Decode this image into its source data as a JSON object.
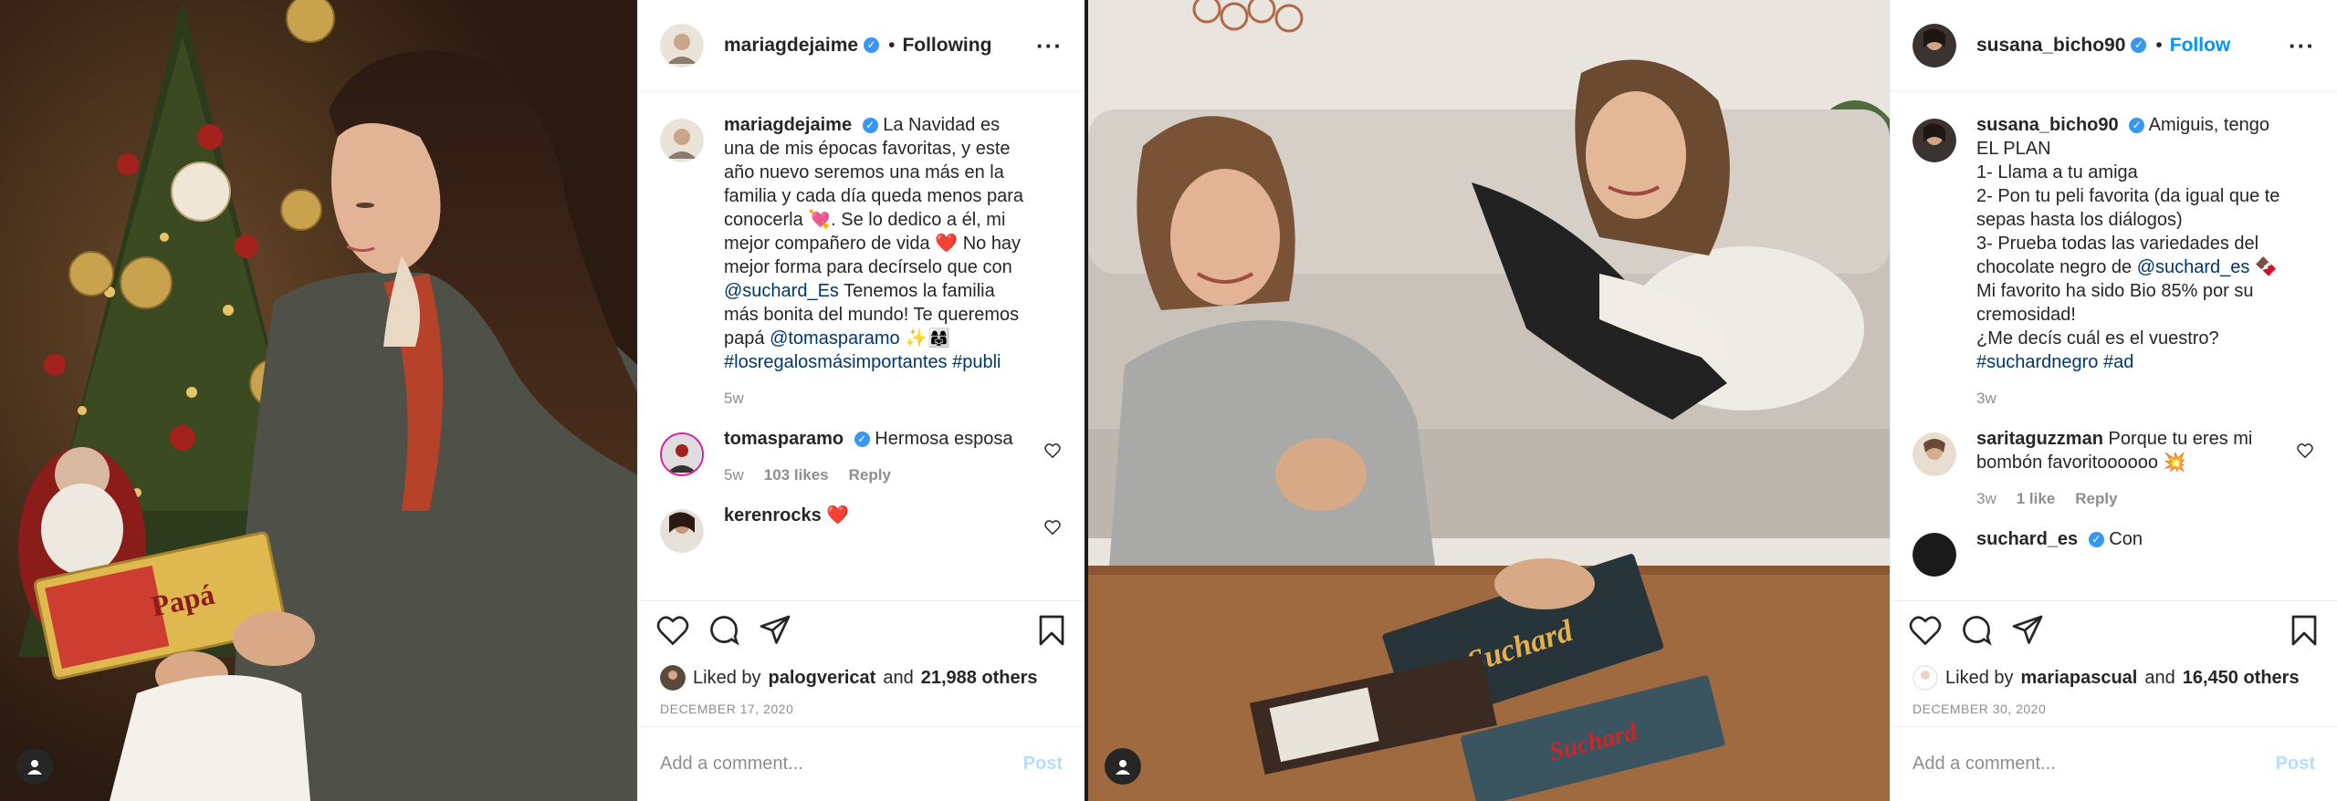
{
  "left_post": {
    "header": {
      "username": "mariagdejaime",
      "follow_state": "Following"
    },
    "caption": {
      "username": "mariagdejaime",
      "text": "La Navidad es una de mis épocas favoritas, y este año nuevo seremos una más en la familia y cada día queda menos para conocerla 💘. Se lo dedico a él, mi mejor compañero de vida ❤️ No hay mejor forma para decírselo que con ",
      "mention1": "@suchard_Es",
      "text2": " Tenemos la familia más bonita del mundo! Te queremos papá ",
      "mention2": "@tomasparamo",
      "emoji": " ✨👩‍👩‍👧",
      "hashtags": "#losregalosmásimportantes #publi",
      "time": "5w"
    },
    "comments": [
      {
        "username": "tomasparamo",
        "text": "Hermosa esposa",
        "time": "5w",
        "likes": "103 likes",
        "reply": "Reply"
      },
      {
        "username": "kerenrocks",
        "text": "❤️"
      }
    ],
    "liked_by": {
      "prefix": "Liked by",
      "user": "palogvericat",
      "and": "and",
      "others": "21,988 others"
    },
    "date": "DECEMBER 17, 2020",
    "add_comment": {
      "placeholder": "Add a comment...",
      "post": "Post"
    }
  },
  "right_post": {
    "header": {
      "username": "susana_bicho90",
      "follow_state": "Follow"
    },
    "caption": {
      "username": "susana_bicho90",
      "text": "Amiguis, tengo EL PLAN\n1- Llama a tu amiga\n2- Pon tu peli favorita (da igual que te sepas hasta los diálogos)\n3- Prueba todas las variedades del chocolate negro de ",
      "mention1": "@suchard_es",
      "text2": " 🍫\nMi favorito ha sido Bio 85% por su cremosidad!\n¿Me decís cuál es el vuestro?\n",
      "hashtags": "#suchardnegro #ad",
      "time": "3w"
    },
    "comments": [
      {
        "username": "saritaguzzman",
        "text": "Porque tu eres mi bombón favoritoooooo 💥",
        "time": "3w",
        "likes": "1 like",
        "reply": "Reply"
      },
      {
        "username": "suchard_es",
        "text": "Con"
      }
    ],
    "liked_by": {
      "prefix": "Liked by",
      "user": "mariapascual",
      "and": "and",
      "others": "16,450 others"
    },
    "date": "DECEMBER 30, 2020",
    "add_comment": {
      "placeholder": "Add a comment...",
      "post": "Post"
    }
  },
  "colors": {
    "link": "#00376b",
    "follow_blue": "#0095f6",
    "verified": "#3897f0",
    "muted": "#8e8e8e",
    "post_disabled": "#b2dffc"
  },
  "icons": [
    "heart-icon",
    "comment-icon",
    "share-icon",
    "bookmark-icon",
    "more-icon",
    "user-tag-icon",
    "verified-icon"
  ]
}
